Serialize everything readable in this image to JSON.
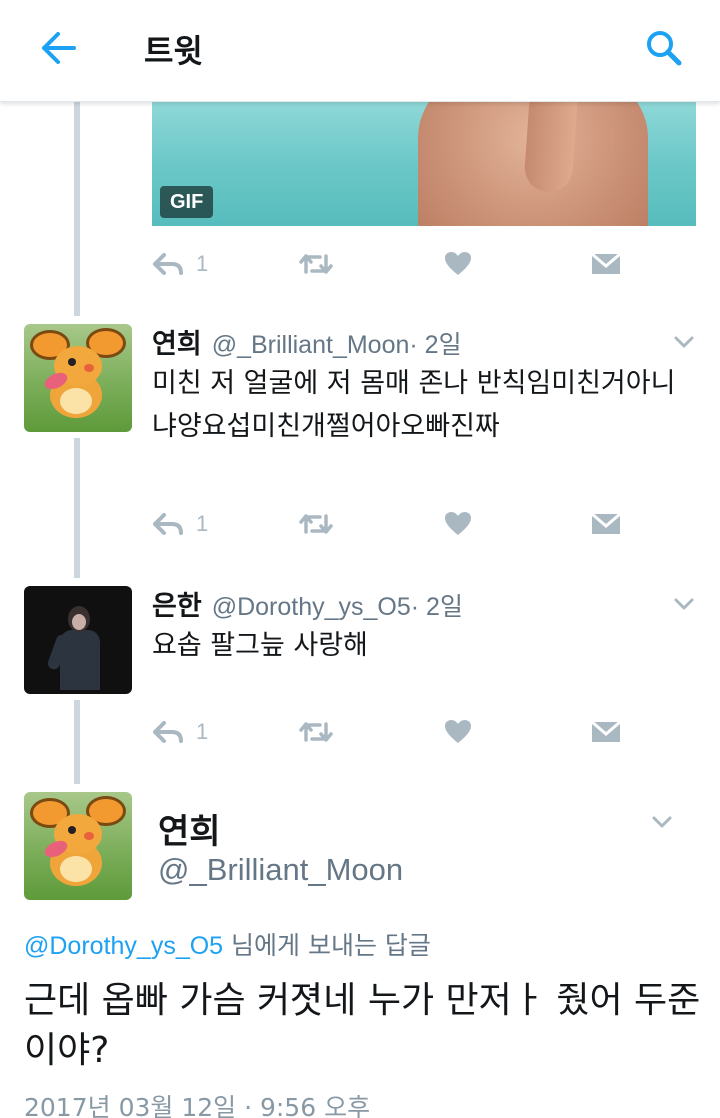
{
  "header": {
    "title": "트윗",
    "back_icon": "arrow-left-icon",
    "search_icon": "search-icon",
    "accent": "#1da1f2"
  },
  "media": {
    "badge": "GIF"
  },
  "tweet0_actions": {
    "reply_count": "1"
  },
  "tweets": [
    {
      "name": "연희",
      "handle": "@_Brilliant_Moon",
      "time": " · 2일",
      "body": "미친 저 얼굴에 저 몸매 존나 반칙임미친거아니냐양요섭미친개쩔어아오빠진짜",
      "reply_count": "1"
    },
    {
      "name": "은한",
      "handle": "@Dorothy_ys_O5",
      "time": " · 2일",
      "body": "요솝 팔그늪 사랑해",
      "reply_count": "1"
    }
  ],
  "focused": {
    "name": "연희",
    "handle": "@_Brilliant_Moon",
    "reply_to": "@Dorothy_ys_O5",
    "reply_suffix": " 님에게 보내는 답글",
    "body": "근데 옵빠 가슴 커졋네 누가 만저ㅏ 줬어 두준이야?",
    "date": "2017년 03월 12일 · 9:56 오후"
  },
  "colors": {
    "icon_gray": "#aab8c2",
    "secondary_text": "#657786",
    "thread_line": "#ccd6dd"
  }
}
